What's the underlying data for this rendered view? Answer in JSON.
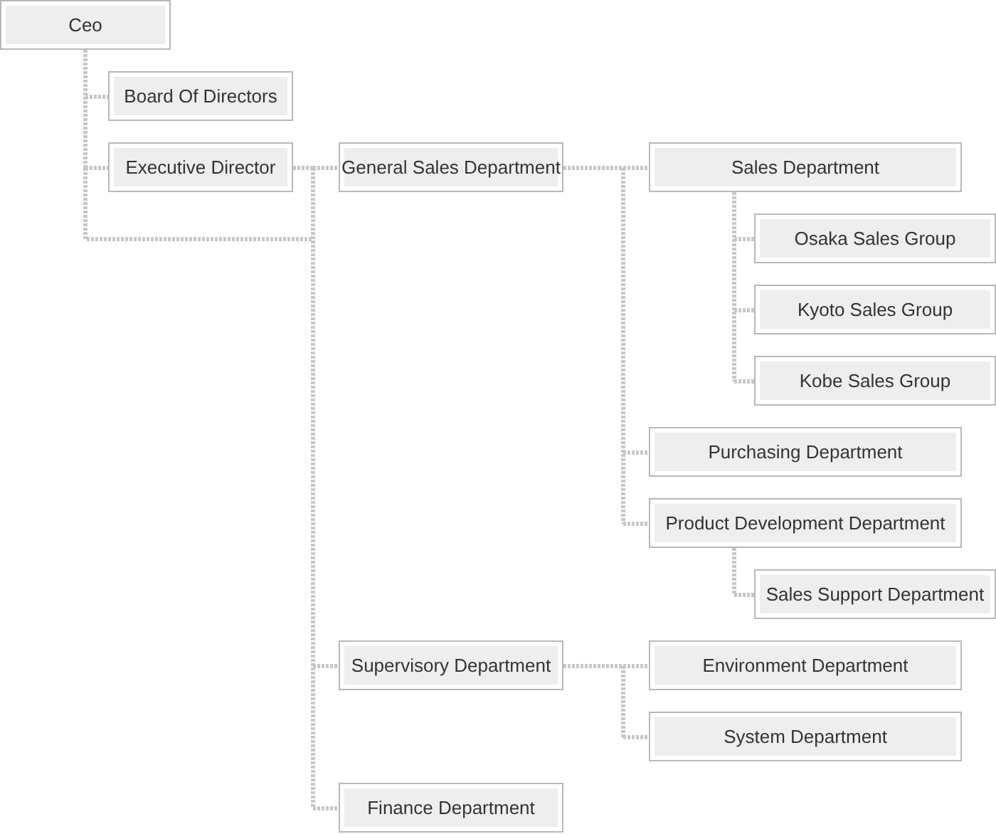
{
  "org_chart": {
    "label": "Ceo",
    "kind": "vertical",
    "children": [
      {
        "label": "Board Of Directors"
      },
      {
        "label": "Executive Director",
        "trunk_from_parent": true,
        "kind": "lateral",
        "children": [
          {
            "label": "General Sales Department",
            "kind": "lateral",
            "children": [
              {
                "label": "Sales Department",
                "kind": "vertical",
                "children": [
                  {
                    "label": "Osaka Sales Group"
                  },
                  {
                    "label": "Kyoto Sales Group"
                  },
                  {
                    "label": "Kobe Sales Group"
                  }
                ]
              },
              {
                "label": "Purchasing Department"
              },
              {
                "label": "Product Development Department",
                "kind": "vertical",
                "children": [
                  {
                    "label": "Sales Support Department"
                  }
                ]
              }
            ]
          },
          {
            "label": "Supervisory Department",
            "kind": "lateral",
            "children": [
              {
                "label": "Environment Department"
              },
              {
                "label": "System Department"
              }
            ]
          },
          {
            "label": "Finance Department"
          }
        ]
      }
    ]
  }
}
